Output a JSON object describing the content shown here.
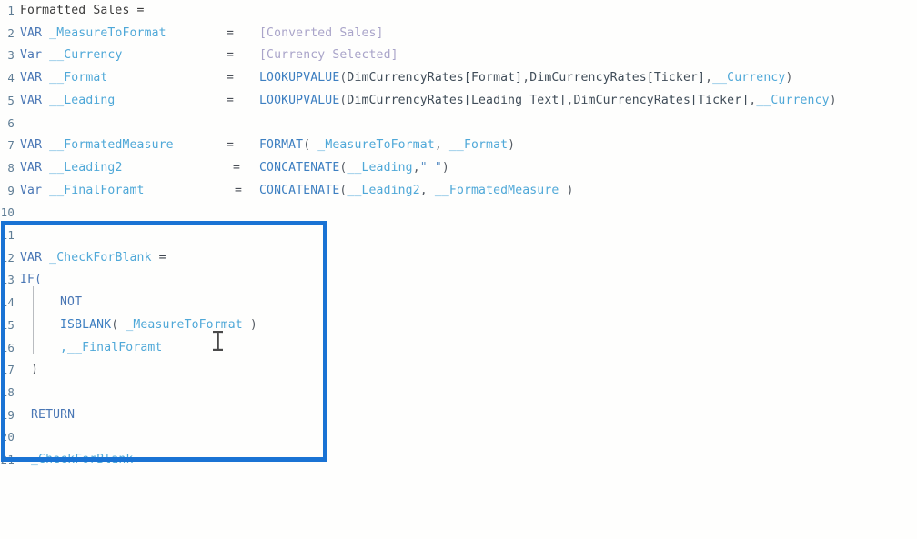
{
  "editor": {
    "language": "DAX",
    "background_color": "#fefefd",
    "gutter_color": "#5f7d95",
    "highlight_box_color": "#1a73d4",
    "indent_guide_color": "#b9bcc0",
    "cursor_icon": "text-ibeam-cursor",
    "equals_sign": "=",
    "line_count": 21
  },
  "lines": [
    {
      "number": "1",
      "text": "Formatted Sales ="
    },
    {
      "number": "2",
      "text": "VAR _MeasureToFormat"
    },
    {
      "number": "3",
      "text": "Var __Currency"
    },
    {
      "number": "4",
      "text": "VAR __Format"
    },
    {
      "number": "5",
      "text": "VAR __Leading"
    },
    {
      "number": "6",
      "text": ""
    },
    {
      "number": "7",
      "text": "VAR __FormatedMeasure"
    },
    {
      "number": "8",
      "text": "VAR __Leading2"
    },
    {
      "number": "9",
      "text": "Var __FinalForamt"
    },
    {
      "number": "10",
      "text": ""
    },
    {
      "number": "11",
      "text": ""
    },
    {
      "number": "12",
      "text": "VAR _CheckForBlank ="
    },
    {
      "number": "13",
      "text": "IF("
    },
    {
      "number": "14",
      "text": "    NOT"
    },
    {
      "number": "15",
      "text": "    ISBLANK( _MeasureToFormat )"
    },
    {
      "number": "16",
      "text": "    ,__FinalForamt"
    },
    {
      "number": "17",
      "text": ")"
    },
    {
      "number": "18",
      "text": ""
    },
    {
      "number": "19",
      "text": "RETURN"
    },
    {
      "number": "20",
      "text": ""
    },
    {
      "number": "21",
      "text": "_CheckForBlank"
    }
  ],
  "expressions": {
    "line2_value": "[Converted Sales]",
    "line3_value": "[Currency Selected]",
    "line4_value": "LOOKUPVALUE(DimCurrencyRates[Format],DimCurrencyRates[Ticker],__Currency)",
    "line5_value": "LOOKUPVALUE(DimCurrencyRates[Leading Text],DimCurrencyRates[Ticker],__Currency)",
    "line7_value": "FORMAT( _MeasureToFormat, __Format)",
    "line8_value": "CONCATENATE(__Leading,\" \")",
    "line9_value": "CONCATENATE(__Leading2, __FormatedMeasure )"
  },
  "tokens": {
    "kw_var_upper": "VAR",
    "kw_var_mixed": "Var",
    "kw_if": "IF(",
    "kw_not": "NOT",
    "kw_return": "RETURN",
    "fn_lookupvalue": "LOOKUPVALUE",
    "fn_format": "FORMAT",
    "fn_concatenate": "CONCATENATE",
    "fn_isblank": "ISBLANK",
    "measure_converted_sales": "[Converted Sales]",
    "measure_currency_selected": "[Currency Selected]",
    "table_format": "DimCurrencyRates[Format]",
    "table_ticker": "DimCurrencyRates[Ticker]",
    "table_leading_text": "DimCurrencyRates[Leading Text]",
    "v_measure_to_format": "_MeasureToFormat",
    "v_currency": "__Currency",
    "v_format": "__Format",
    "v_leading": "__Leading",
    "v_leading2": "__Leading2",
    "v_formated_measure": "__FormatedMeasure",
    "v_final_foramt": "__FinalForamt",
    "v_check_for_blank": "_CheckForBlank",
    "title_line": "Formatted Sales =",
    "space_string": "\" \"",
    "close_paren": ")",
    "comma_final_foramt": ",__FinalForamt"
  }
}
